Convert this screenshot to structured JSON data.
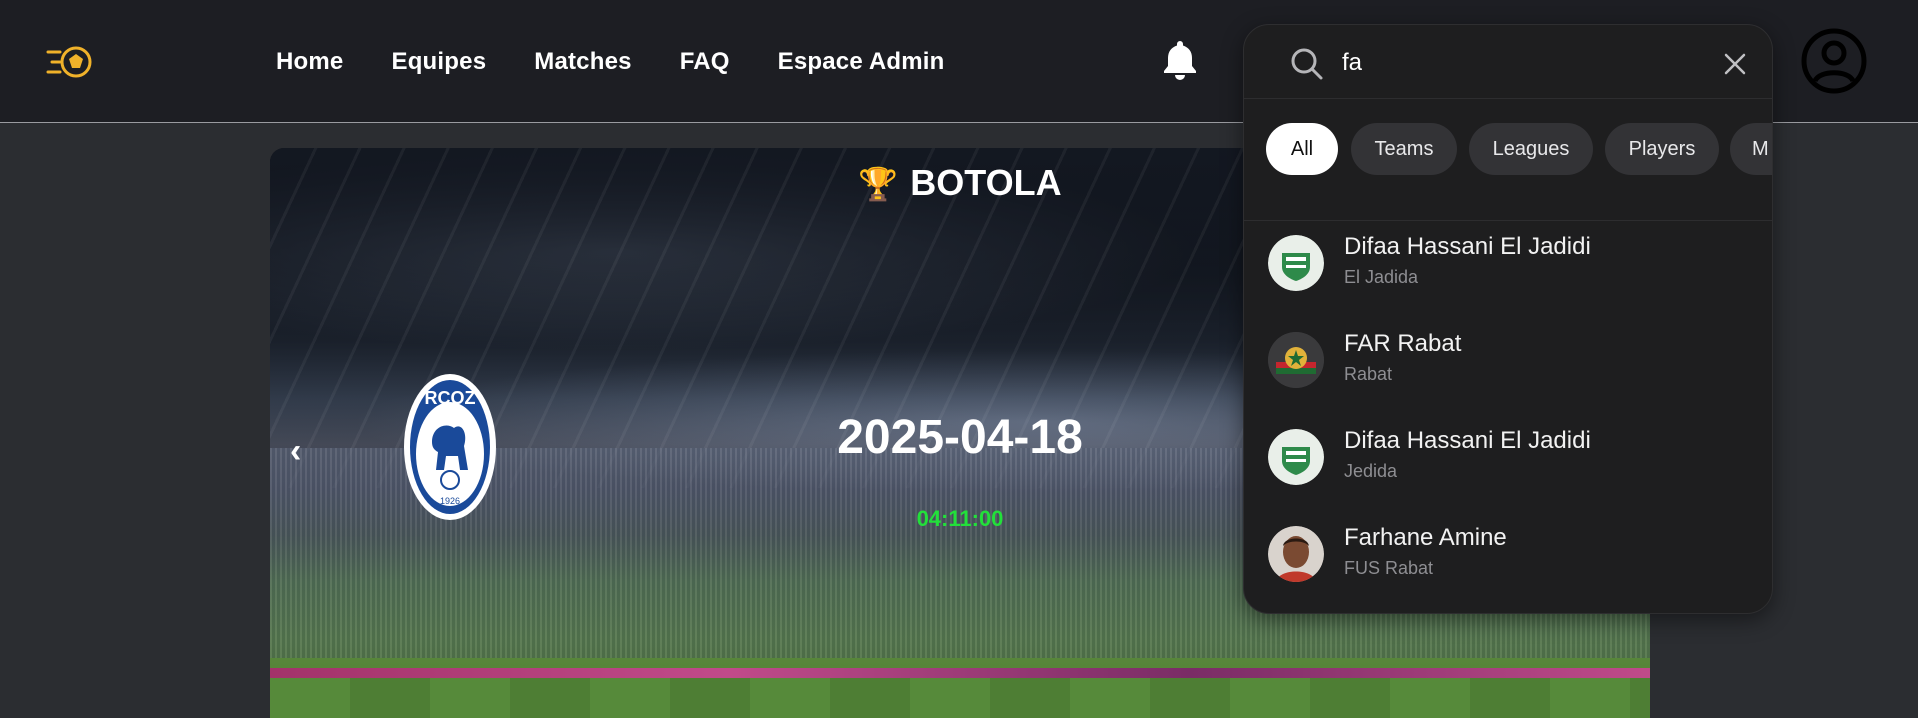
{
  "header": {
    "nav": [
      "Home",
      "Equipes",
      "Matches",
      "FAQ",
      "Espace Admin"
    ],
    "logo_icon": "football-logo-icon",
    "bell_icon": "bell-icon",
    "avatar_icon": "user-circle-icon"
  },
  "hero": {
    "league": "BOTOLA",
    "trophy_icon": "🏆",
    "club_badge_text": "RCOZ",
    "club_badge_year": "1926",
    "date": "2025-04-18",
    "countdown": "04:11:00",
    "prev_arrow": "‹"
  },
  "search": {
    "query": "fa",
    "filters": [
      "All",
      "Teams",
      "Leagues",
      "Players",
      "M"
    ],
    "active_filter": "All",
    "results": [
      {
        "name": "Difaa Hassani El Jadidi",
        "subtitle": "El Jadida",
        "kind": "team"
      },
      {
        "name": "FAR Rabat",
        "subtitle": "Rabat",
        "kind": "team"
      },
      {
        "name": "Difaa Hassani El Jadidi",
        "subtitle": "Jedida",
        "kind": "team"
      },
      {
        "name": "Farhane Amine",
        "subtitle": "FUS Rabat",
        "kind": "player"
      }
    ]
  },
  "colors": {
    "background": "#2b2d31",
    "header": "#1d1e23",
    "accent_logo": "#f0b22a",
    "countdown": "#22e03a",
    "popup": "#1e1e1f"
  }
}
